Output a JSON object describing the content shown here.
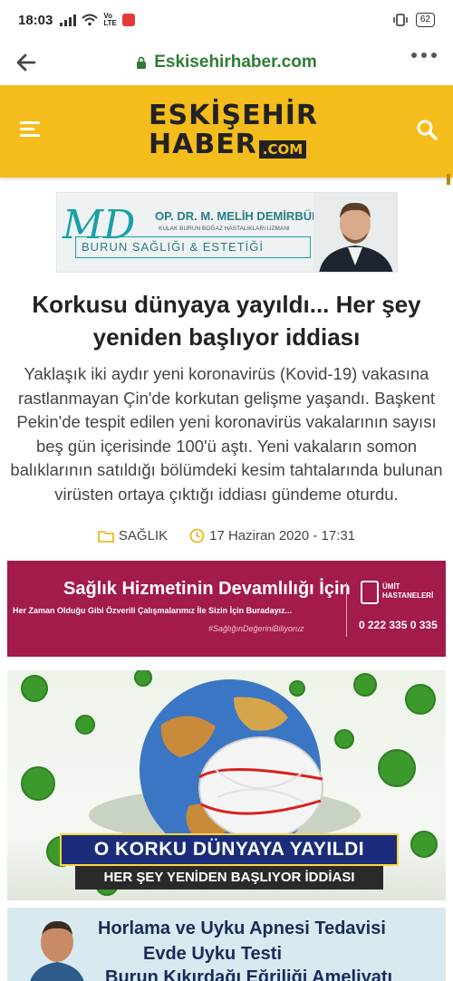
{
  "status": {
    "time": "18:03",
    "volte_top": "Vo",
    "volte_bottom": "LTE",
    "battery": "62"
  },
  "browser": {
    "url": "Eskisehirhaber.com"
  },
  "site": {
    "logo_line1": "ESKİŞEHİR",
    "logo_line2": "HABER",
    "logo_com": ".COM",
    "brand_color": "#f5bd1b"
  },
  "ad_doctor": {
    "logo": "MD",
    "name": "OP. DR. M. MELİH DEMİRBÜKEN",
    "subtitle": "KULAK BURUN BOĞAZ HASTALIKLARI UZMANI",
    "specialty": "BURUN SAĞLIĞI & ESTETİĞİ"
  },
  "article": {
    "title": "Korkusu dünyaya yayıldı... Her şey yeniden başlıyor iddiası",
    "summary": "Yaklaşık iki aydır yeni koronavirüs (Kovid-19) vakasına rastlanmayan Çin'de korkutan gelişme yaşandı. Başkent Pekin'de tespit edilen yeni koronavirüs vakalarının sayısı beş gün içerisinde 100'ü aştı. Yeni vakaların somon balıklarının satıldığı bölümdeki kesim tahtalarında bulunan virüsten ortaya çıktığı iddiası gündeme oturdu.",
    "category": "SAĞLIK",
    "date": "17 Haziran 2020 - 17:31"
  },
  "ad_hospital": {
    "headline": "Sağlık Hizmetinin Devamlılığı İçin",
    "subline": "Her Zaman Olduğu Gibi Özverili Çalışmalarımız İle Sizin İçin Buradayız...",
    "hashtag": "#SağlığınDeğeriniBiliyoruz",
    "hospital_top": "ÜMİT",
    "hospital_bottom": "HASTANELERİ",
    "phone": "0 222 335 0 335"
  },
  "hero_image": {
    "banner_line1": "O KORKU DÜNYAYA YAYILDI",
    "banner_line2": "HER ŞEY YENİDEN BAŞLIYOR İDDİASI"
  },
  "ad_sleep": {
    "line1": "Horlama ve Uyku Apnesi Tedavisi",
    "line2": "Evde Uyku Testi",
    "line3": "Burun Kıkırdağı Eğriliği Ameliyatı"
  },
  "icons": {
    "back": "arrow-left-icon",
    "lock": "lock-icon",
    "more": "more-vertical-icon",
    "menu": "menu-icon",
    "search": "search-icon",
    "folder": "folder-icon",
    "clock": "clock-icon"
  }
}
